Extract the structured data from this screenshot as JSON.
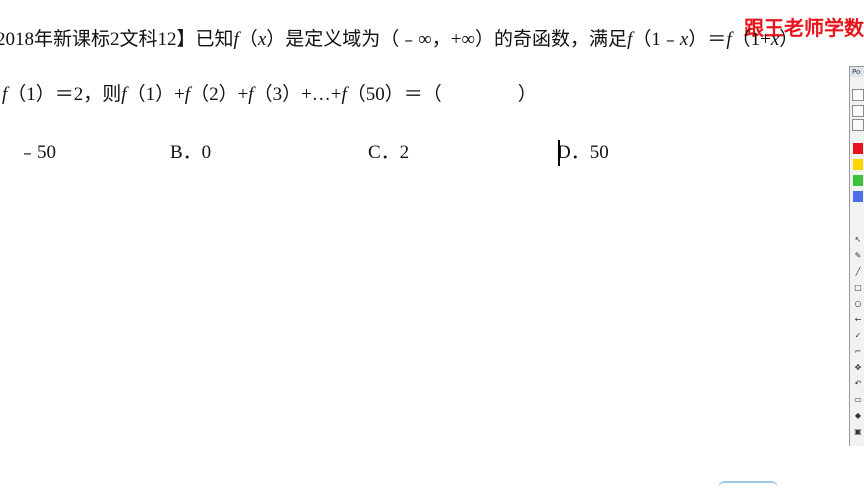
{
  "watermark": "跟王老师学数",
  "question": {
    "line1": [
      {
        "text": "2018年新课标2文科12】已知",
        "italic": false
      },
      {
        "text": "f",
        "italic": true
      },
      {
        "text": "（",
        "italic": false
      },
      {
        "text": "x",
        "italic": true
      },
      {
        "text": "）是定义域为（﹣∞，+∞）的奇函数，满足",
        "italic": false
      },
      {
        "text": "f",
        "italic": true
      },
      {
        "text": "（1﹣",
        "italic": false
      },
      {
        "text": "x",
        "italic": true
      },
      {
        "text": "）＝",
        "italic": false
      },
      {
        "text": "f",
        "italic": true
      },
      {
        "text": "（1+",
        "italic": false
      },
      {
        "text": "x",
        "italic": true
      },
      {
        "text": "）",
        "italic": false
      }
    ],
    "line2": [
      {
        "text": "f",
        "italic": true
      },
      {
        "text": "（1）＝2，则",
        "italic": false
      },
      {
        "text": "f",
        "italic": true
      },
      {
        "text": "（1）+",
        "italic": false
      },
      {
        "text": "f",
        "italic": true
      },
      {
        "text": "（2）+",
        "italic": false
      },
      {
        "text": "f",
        "italic": true
      },
      {
        "text": "（3）+…+",
        "italic": false
      },
      {
        "text": "f",
        "italic": true
      },
      {
        "text": "（50）＝（　　　　）",
        "italic": false
      }
    ]
  },
  "choices": {
    "a": "﹣50",
    "b": "B．0",
    "c": "C．2",
    "d": "D．50"
  },
  "palette": {
    "title": "Po",
    "swatch_colors": [
      "#e8141b",
      "#ffd400",
      "#3cc23c",
      "#4a6fe8"
    ],
    "tools": [
      "pointer-icon",
      "pen-icon",
      "line-icon",
      "rectangle-icon",
      "ellipse-icon",
      "arrow-icon",
      "check-icon",
      "frame-icon",
      "move-icon",
      "undo-icon",
      "clear-icon",
      "eraser-icon",
      "screen-icon"
    ]
  }
}
